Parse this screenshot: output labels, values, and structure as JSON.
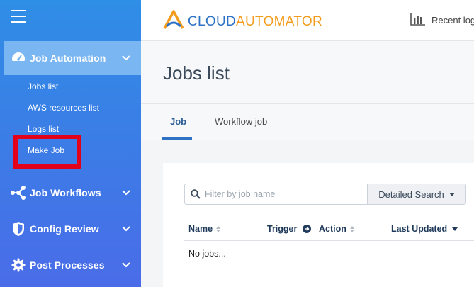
{
  "sidebar": {
    "sections": [
      {
        "label": "Job Automation",
        "icon": "dashboard-icon"
      },
      {
        "label": "Job Workflows",
        "icon": "workflow-icon"
      },
      {
        "label": "Config Review",
        "icon": "shield-icon"
      },
      {
        "label": "Post Processes",
        "icon": "gear-icon"
      }
    ],
    "sub_items": [
      "Jobs list",
      "AWS resources list",
      "Logs list",
      "Make Job"
    ],
    "highlighted_item": "Make Job",
    "colors": {
      "gradient_top": "#2f8ee6",
      "gradient_bottom": "#4a6ce8",
      "active_bg": "#79b6f2",
      "highlight": "#e3001b"
    }
  },
  "header": {
    "brand_cloud": "CLOUD",
    "brand_automator": "AUTOMATOR",
    "recent_label": "Recent log",
    "colors": {
      "brand_blue": "#2d72c4",
      "brand_orange": "#f39c1c"
    }
  },
  "page": {
    "title": "Jobs list",
    "tabs": [
      "Job",
      "Workflow job"
    ],
    "active_tab": "Job"
  },
  "filter": {
    "placeholder": "Filter by job name",
    "detailed_search_label": "Detailed Search"
  },
  "table": {
    "columns": [
      "Name",
      "Trigger",
      "Action",
      "Last Updated"
    ],
    "empty_text": "No jobs..."
  }
}
